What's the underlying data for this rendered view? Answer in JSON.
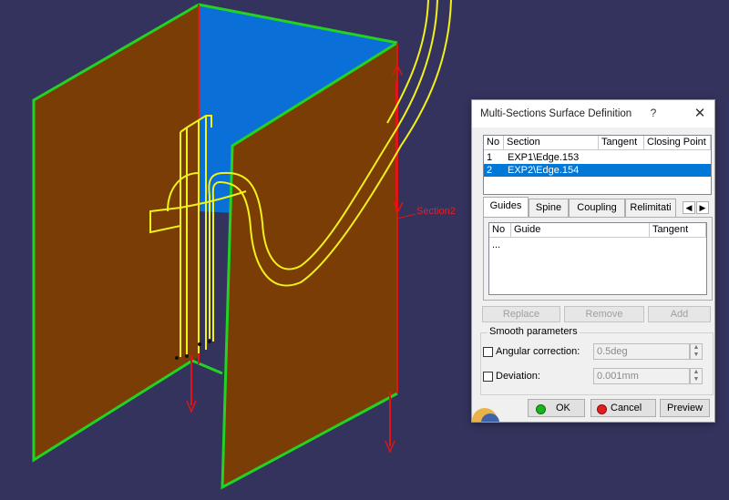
{
  "viewport": {
    "section_label": "Section2",
    "colors": {
      "background": "#33335e",
      "surface": "#7a3d05",
      "surface_inner": "#0a6fd6",
      "edge_green": "#22d322",
      "edge_red": "#e01515",
      "curve_yellow": "#f2f21a"
    }
  },
  "dialog": {
    "title": "Multi-Sections Surface Definition",
    "help_label": "?",
    "close_label": "✕",
    "sections_table": {
      "headers": [
        "No",
        "Section",
        "Tangent",
        "Closing Point"
      ],
      "rows": [
        {
          "no": "1",
          "section": "EXP1\\Edge.153",
          "tangent": "",
          "closing_point": "",
          "selected": false
        },
        {
          "no": "2",
          "section": "EXP2\\Edge.154",
          "tangent": "",
          "closing_point": "",
          "selected": true
        }
      ]
    },
    "tabs": [
      "Guides",
      "Spine",
      "Coupling",
      "Relimitati"
    ],
    "active_tab": "Guides",
    "guides_table": {
      "headers": [
        "No",
        "Guide",
        "Tangent"
      ],
      "rows": [
        "..."
      ]
    },
    "buttons": {
      "replace": "Replace",
      "remove": "Remove",
      "add": "Add"
    },
    "smooth": {
      "legend": "Smooth parameters",
      "angular_label": "Angular correction:",
      "angular_value": "0.5deg",
      "angular_checked": false,
      "deviation_label": "Deviation:",
      "deviation_value": "0.001mm",
      "deviation_checked": false
    },
    "footer": {
      "ok": "OK",
      "cancel": "Cancel",
      "preview": "Preview"
    }
  }
}
